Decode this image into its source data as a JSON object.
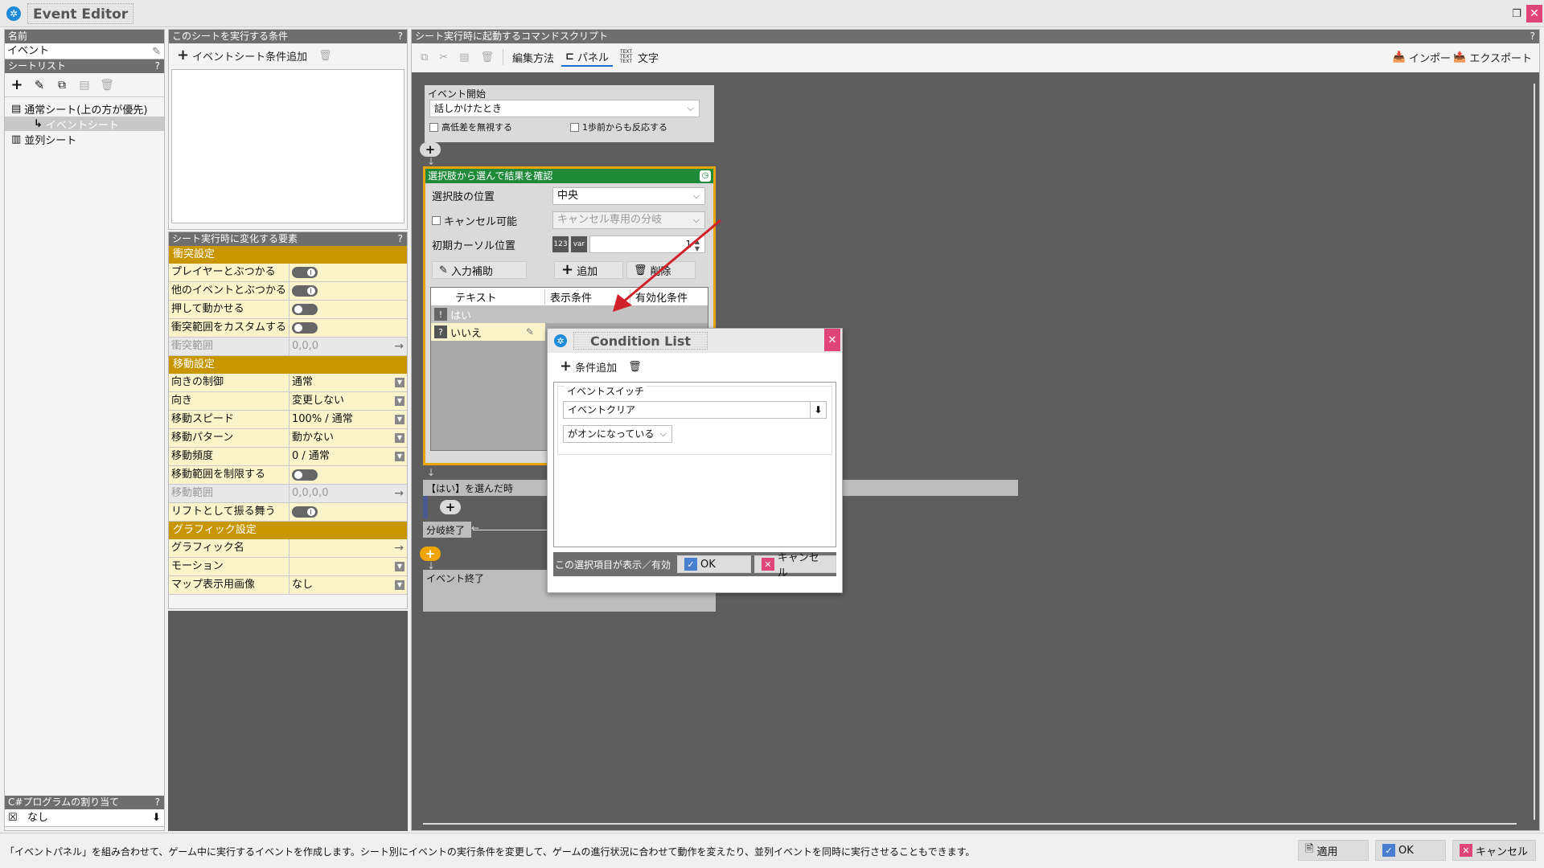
{
  "window": {
    "title": "Event Editor"
  },
  "left": {
    "name_header": "名前",
    "name_value": "イベント",
    "sheetlist_header": "シートリスト",
    "tree": [
      {
        "label": "通常シート(上の方が優先)"
      },
      {
        "label": "イベントシート"
      },
      {
        "label": "並列シート"
      }
    ],
    "csharp_header": "C#プログラムの割り当て",
    "csharp_value": "なし"
  },
  "conditions": {
    "header": "このシートを実行する条件",
    "add_label": "イベントシート条件追加"
  },
  "props": {
    "header": "シート実行時に変化する要素",
    "collision": {
      "title": "衝突設定",
      "rows": [
        {
          "label": "プレイヤーとぶつかる"
        },
        {
          "label": "他のイベントとぶつかる"
        },
        {
          "label": "押して動かせる"
        },
        {
          "label": "衝突範囲をカスタムする"
        },
        {
          "label": "衝突範囲",
          "value": "0,0,0"
        }
      ]
    },
    "movement": {
      "title": "移動設定",
      "rows": [
        {
          "label": "向きの制御",
          "value": "通常"
        },
        {
          "label": "向き",
          "value": "変更しない"
        },
        {
          "label": "移動スピード",
          "value": "100% / 通常"
        },
        {
          "label": "移動パターン",
          "value": "動かない"
        },
        {
          "label": "移動頻度",
          "value": "0 / 通常"
        },
        {
          "label": "移動範囲を制限する"
        },
        {
          "label": "移動範囲",
          "value": "0,0,0,0"
        },
        {
          "label": "リフトとして振る舞う"
        }
      ]
    },
    "graphics": {
      "title": "グラフィック設定",
      "rows": [
        {
          "label": "グラフィック名",
          "value": ""
        },
        {
          "label": "モーション",
          "value": ""
        },
        {
          "label": "マップ表示用画像",
          "value": "なし"
        }
      ]
    }
  },
  "script": {
    "header": "シート実行時に起動するコマンドスクリプト",
    "toolbar": {
      "edit_method": "編集方法",
      "panel": "パネル",
      "text": "文字",
      "import": "インポート",
      "export": "エクスポート",
      "text_icon": "TEXT TEXT TEXT"
    },
    "event_start": {
      "title": "イベント開始",
      "trigger": "話しかけたとき",
      "ignore_height": "高低差を無視する",
      "react_before": "1歩前からも反応する"
    },
    "choice": {
      "title": "選択肢から選んで結果を確認",
      "position_label": "選択肢の位置",
      "position_value": "中央",
      "cancel_label": "キャンセル可能",
      "cancel_branch": "キャンセル専用の分岐",
      "cursor_label": "初期カーソル位置",
      "cursor_value": "1",
      "num_icon": "123",
      "var_icon": "var",
      "input_assist": "入力補助",
      "add": "追加",
      "delete": "削除",
      "columns": [
        "テキスト",
        "表示条件",
        "有効化条件"
      ],
      "items": [
        {
          "text": "はい"
        },
        {
          "text": "いいえ"
        }
      ]
    },
    "branch_yes": "【はい】を選んだ時",
    "branch_end": "分岐終了",
    "event_end": "イベント終了"
  },
  "dialog": {
    "title": "Condition List",
    "add_condition": "条件追加",
    "group_title": "イベントスイッチ",
    "switch_value": "イベントクリア",
    "state_value": "がオンになっている",
    "footer_note": "この選択項目が表示／有効",
    "ok": "OK",
    "cancel": "キャンセル"
  },
  "statusbar": {
    "message": "「イベントパネル」を組み合わせて、ゲーム中に実行するイベントを作成します。シート別にイベントの実行条件を変更して、ゲームの進行状況に合わせて動作を変えたり、並列イベントを同時に実行させることもできます。",
    "apply": "適用",
    "ok": "OK",
    "cancel": "キャンセル"
  },
  "colors": {
    "accent_orange": "#c89600",
    "panel_green": "#1f8a3a",
    "close_pink": "#e0457a",
    "arrow_red": "#d0202a"
  }
}
